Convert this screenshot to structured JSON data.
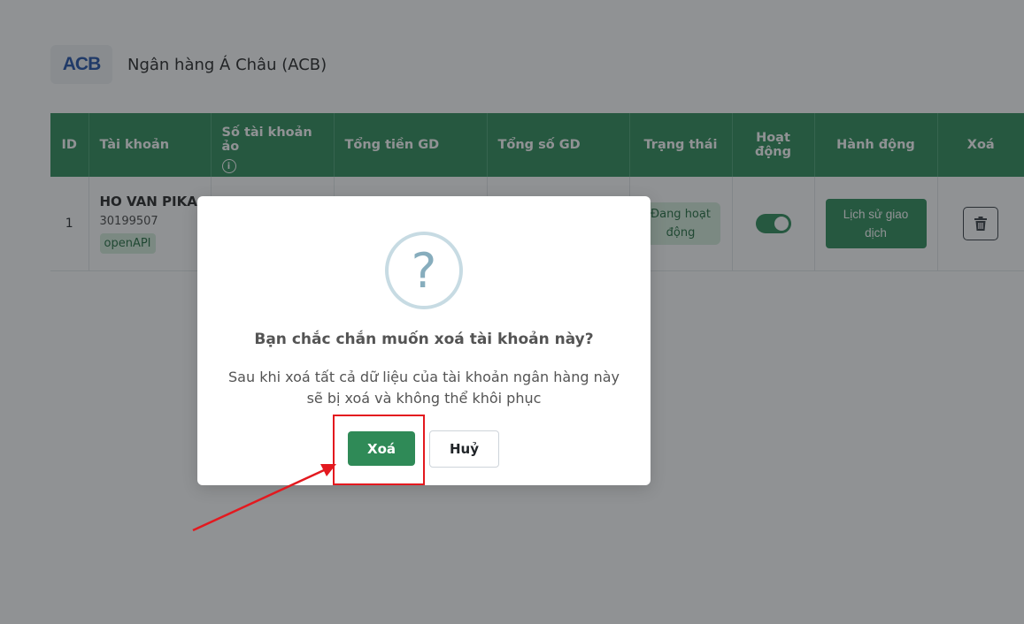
{
  "bank": {
    "logo_text": "ACB",
    "name": "Ngân hàng Á Châu (ACB)"
  },
  "table": {
    "headers": {
      "id": "ID",
      "account": "Tài khoản",
      "virtual_account": "Số tài khoản ảo",
      "total_amount": "Tổng tiền GD",
      "total_count": "Tổng số GD",
      "status": "Trạng thái",
      "active": "Hoạt động",
      "action": "Hành động",
      "delete": "Xoá"
    },
    "rows": [
      {
        "id": "1",
        "account_name": "HO VAN PIKA",
        "account_number": "30199507",
        "tag": "openAPI",
        "status": "Đang hoạt động",
        "active": true,
        "action_label": "Lịch sử giao dịch"
      }
    ]
  },
  "dialog": {
    "icon": "?",
    "title": "Bạn chắc chắn muốn xoá tài khoản này?",
    "message": "Sau khi xoá tất cả dữ liệu của tài khoản ngân hàng này sẽ bị xoá và không thể khôi phục",
    "confirm_label": "Xoá",
    "cancel_label": "Huỷ"
  },
  "colors": {
    "primary": "#2a8a57",
    "badge_bg": "#d4edda",
    "annotation": "#e3191f"
  },
  "icons": {
    "info": "info-icon",
    "trash": "trash-icon",
    "question": "question-icon"
  }
}
